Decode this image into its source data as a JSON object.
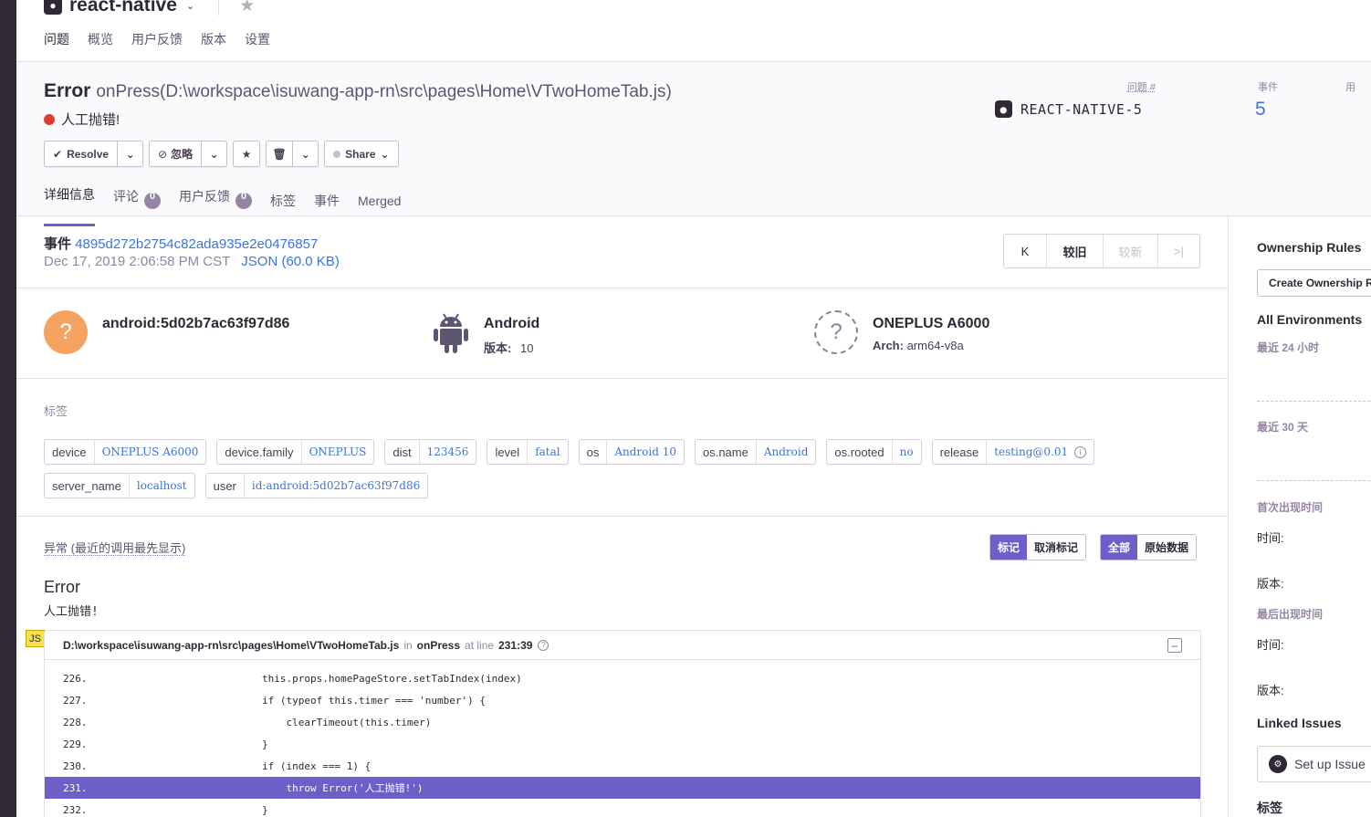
{
  "project": {
    "name": "react-native",
    "nav": [
      "问题",
      "概览",
      "用户反馈",
      "版本",
      "设置"
    ]
  },
  "issue": {
    "type": "Error",
    "culprit": "onPress(D:\\workspace\\isuwang-app-rn\\src\\pages\\Home\\VTwoHomeTab.js)",
    "message": "人工抛错!",
    "actions": {
      "resolve": "Resolve",
      "ignore": "忽略",
      "share": "Share"
    },
    "short_id_label": "问题 #",
    "short_id": "REACT-NATIVE-5",
    "events_label": "事件",
    "events_count": "5",
    "users_label": "用",
    "tabs": {
      "details": "详细信息",
      "comments": "评论",
      "comments_count": "0",
      "feedback": "用户反馈",
      "feedback_count": "0",
      "tags": "标签",
      "events": "事件",
      "merged": "Merged"
    }
  },
  "event": {
    "label": "事件",
    "id": "4895d272b2754c82ada935e2e0476857",
    "date": "Dec 17, 2019 2:06:58 PM CST",
    "json": "JSON (60.0 KB)",
    "pager": {
      "first": "K",
      "older": "较旧",
      "newer": "较新",
      "last": ">|"
    }
  },
  "context": {
    "user": "android:5d02b7ac63f97d86",
    "os_name": "Android",
    "os_version_label": "版本:",
    "os_version": "10",
    "device_name": "ONEPLUS A6000",
    "arch_label": "Arch:",
    "arch": "arm64-v8a"
  },
  "tags_section": {
    "label": "标签",
    "items": [
      {
        "k": "device",
        "v": "ONEPLUS A6000"
      },
      {
        "k": "device.family",
        "v": "ONEPLUS"
      },
      {
        "k": "dist",
        "v": "123456"
      },
      {
        "k": "level",
        "v": "fatal"
      },
      {
        "k": "os",
        "v": "Android 10"
      },
      {
        "k": "os.name",
        "v": "Android"
      },
      {
        "k": "os.rooted",
        "v": "no"
      },
      {
        "k": "release",
        "v": "testing@0.01"
      },
      {
        "k": "server_name",
        "v": "localhost"
      },
      {
        "k": "user",
        "v": "id:android:5d02b7ac63f97d86"
      }
    ]
  },
  "exception": {
    "header": "异常 (最近的调用最先显示)",
    "toggle_a": [
      "标记",
      "取消标记"
    ],
    "toggle_b": [
      "全部",
      "原始数据"
    ],
    "type": "Error",
    "value": "人工抛错!",
    "platform_badge": "JS",
    "frame": {
      "file": "D:\\workspace\\isuwang-app-rn\\src\\pages\\Home\\VTwoHomeTab.js",
      "in": "in",
      "function": "onPress",
      "at_line": "at line",
      "line": "231:39"
    },
    "code": [
      {
        "ln": "226.",
        "text": "this.props.homePageStore.setTabIndex(index)"
      },
      {
        "ln": "227.",
        "text": "if (typeof this.timer === 'number') {"
      },
      {
        "ln": "228.",
        "text": "    clearTimeout(this.timer)"
      },
      {
        "ln": "229.",
        "text": "}"
      },
      {
        "ln": "230.",
        "text": "if (index === 1) {"
      },
      {
        "ln": "231.",
        "text": "    throw Error('人工抛错!')"
      },
      {
        "ln": "232.",
        "text": "}"
      }
    ]
  },
  "sidebar": {
    "ownership_title": "Ownership Rules",
    "ownership_button": "Create Ownership R",
    "env_title": "All Environments",
    "last_24h": "最近 24 小时",
    "last_30d": "最近 30 天",
    "first_seen": "首次出现时间",
    "time_label": "时间:",
    "version_label": "版本:",
    "last_seen": "最后出现时间",
    "time_label_2": "时间:",
    "version_label_2": "版本:",
    "linked_issues": "Linked Issues",
    "setup_issue": "Set up Issue",
    "tags_title": "标签"
  }
}
